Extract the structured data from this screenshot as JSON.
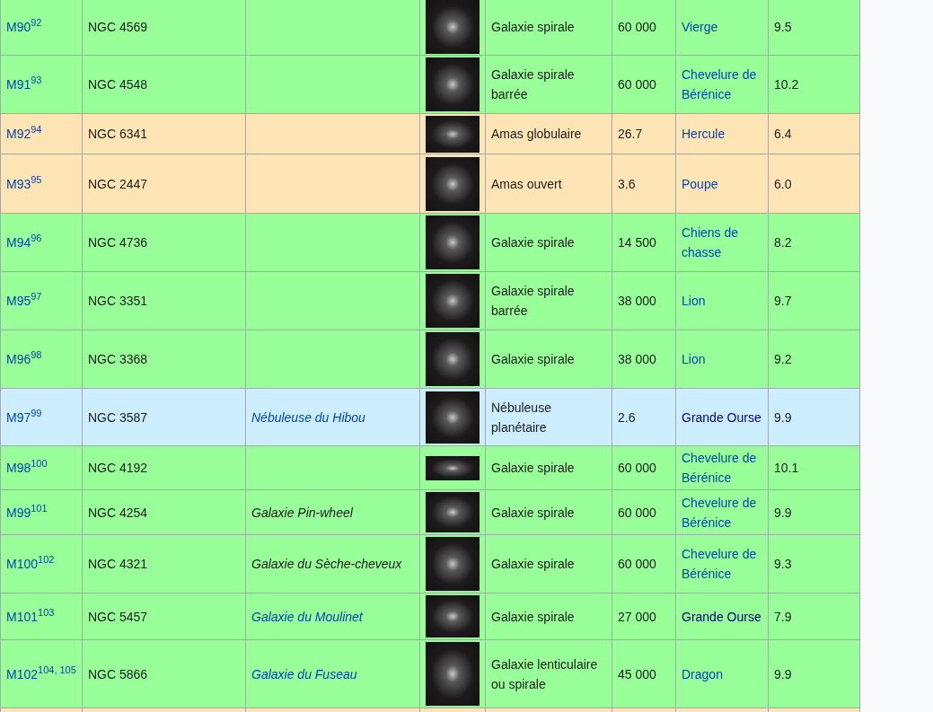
{
  "rows": [
    {
      "kind": "galaxy",
      "messier": "M90",
      "ref": "92",
      "ngc": "NGC 4569",
      "type": "Galaxie spirale",
      "distance": "60 000",
      "constellation": {
        "text": "Vierge",
        "visited": false
      },
      "magnitude": "9.5"
    },
    {
      "kind": "galaxy",
      "messier": "M91",
      "ref": "93",
      "ngc": "NGC 4548",
      "type": "Galaxie spirale barrée",
      "distance": "60 000",
      "constellation": {
        "text": "Chevelure de Bérénice",
        "visited": false
      },
      "magnitude": "10.2"
    },
    {
      "kind": "cluster",
      "messier": "M92",
      "ref": "94",
      "ngc": "NGC 6341",
      "type": "Amas globulaire",
      "distance": "26.7",
      "constellation": {
        "text": "Hercule",
        "visited": false
      },
      "magnitude": "6.4"
    },
    {
      "kind": "cluster",
      "messier": "M93",
      "ref": "95",
      "ngc": "NGC 2447",
      "type": "Amas ouvert",
      "distance": "3.6",
      "constellation": {
        "text": "Poupe",
        "visited": false
      },
      "magnitude": "6.0"
    },
    {
      "kind": "galaxy",
      "messier": "M94",
      "ref": "96",
      "ngc": "NGC 4736",
      "type": "Galaxie spirale",
      "distance": "14 500",
      "constellation": {
        "text": "Chiens de chasse",
        "visited": false
      },
      "magnitude": "8.2"
    },
    {
      "kind": "galaxy",
      "messier": "M95",
      "ref": "97",
      "ngc": "NGC 3351",
      "type": "Galaxie spirale barrée",
      "distance": "38 000",
      "constellation": {
        "text": "Lion",
        "visited": false
      },
      "magnitude": "9.7"
    },
    {
      "kind": "galaxy",
      "messier": "M96",
      "ref": "98",
      "ngc": "NGC 3368",
      "type": "Galaxie spirale",
      "distance": "38 000",
      "constellation": {
        "text": "Lion",
        "visited": false
      },
      "magnitude": "9.2"
    },
    {
      "kind": "nebula",
      "messier": "M97",
      "ref": "99",
      "ngc": "NGC 3587",
      "name": {
        "text": "Nébuleuse du Hibou",
        "link": true
      },
      "type": "Nébuleuse planétaire",
      "distance": "2.6",
      "constellation": {
        "text": "Grande Ourse",
        "visited": true
      },
      "magnitude": "9.9"
    },
    {
      "kind": "galaxy",
      "messier": "M98",
      "ref": "100",
      "ngc": "NGC 4192",
      "type": "Galaxie spirale",
      "distance": "60 000",
      "constellation": {
        "text": "Chevelure de Bérénice",
        "visited": false
      },
      "magnitude": "10.1"
    },
    {
      "kind": "galaxy",
      "messier": "M99",
      "ref": "101",
      "ngc": "NGC 4254",
      "name": {
        "text": "Galaxie Pin-wheel",
        "link": false
      },
      "type": "Galaxie spirale",
      "distance": "60 000",
      "constellation": {
        "text": "Chevelure de Bérénice",
        "visited": false
      },
      "magnitude": "9.9"
    },
    {
      "kind": "galaxy",
      "messier": "M100",
      "ref": "102",
      "ngc": "NGC 4321",
      "name": {
        "text": "Galaxie du Sèche-cheveux",
        "link": false
      },
      "type": "Galaxie spirale",
      "distance": "60 000",
      "constellation": {
        "text": "Chevelure de Bérénice",
        "visited": false
      },
      "magnitude": "9.3"
    },
    {
      "kind": "galaxy",
      "messier": "M101",
      "ref": "103",
      "ngc": "NGC 5457",
      "name": {
        "text": "Galaxie du Moulinet",
        "link": true
      },
      "type": "Galaxie spirale",
      "distance": "27 000",
      "constellation": {
        "text": "Grande Ourse",
        "visited": true
      },
      "magnitude": "7.9"
    },
    {
      "kind": "galaxy",
      "messier": "M102",
      "ref": "104, 105",
      "ngc": "NGC 5866",
      "name": {
        "text": "Galaxie du Fuseau",
        "link": true
      },
      "type": "Galaxie lenticulaire ou spirale",
      "distance": "45 000",
      "constellation": {
        "text": "Dragon",
        "visited": false
      },
      "magnitude": "9.9"
    },
    {
      "kind": "cluster"
    }
  ]
}
